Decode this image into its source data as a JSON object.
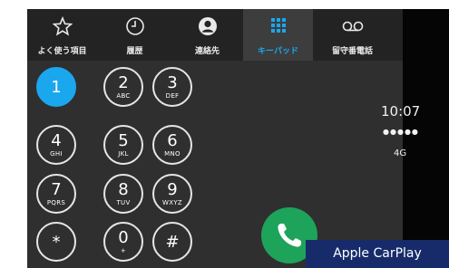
{
  "tabs": [
    {
      "label": "よく使う項目",
      "icon": "star-icon",
      "active": false
    },
    {
      "label": "履歴",
      "icon": "clock-icon",
      "active": false
    },
    {
      "label": "連絡先",
      "icon": "contact-icon",
      "active": false
    },
    {
      "label": "キーパッド",
      "icon": "keypad-icon",
      "active": true
    },
    {
      "label": "留守番電話",
      "icon": "voicemail-icon",
      "active": false
    }
  ],
  "keys": [
    {
      "digit": "1",
      "letters": ""
    },
    {
      "digit": "2",
      "letters": "ABC"
    },
    {
      "digit": "3",
      "letters": "DEF"
    },
    {
      "digit": "4",
      "letters": "GHI"
    },
    {
      "digit": "5",
      "letters": "JKL"
    },
    {
      "digit": "6",
      "letters": "MNO"
    },
    {
      "digit": "7",
      "letters": "PQRS"
    },
    {
      "digit": "8",
      "letters": "TUV"
    },
    {
      "digit": "9",
      "letters": "WXYZ"
    },
    {
      "digit": "*",
      "letters": ""
    },
    {
      "digit": "0",
      "letters": "+"
    },
    {
      "digit": "#",
      "letters": ""
    }
  ],
  "status": {
    "time": "10:07",
    "signal": "●●●●●",
    "network": "4G"
  },
  "banner": "Apple CarPlay",
  "colors": {
    "accent": "#1aa7ee",
    "call": "#1ea35a",
    "banner": "#172b6b"
  }
}
